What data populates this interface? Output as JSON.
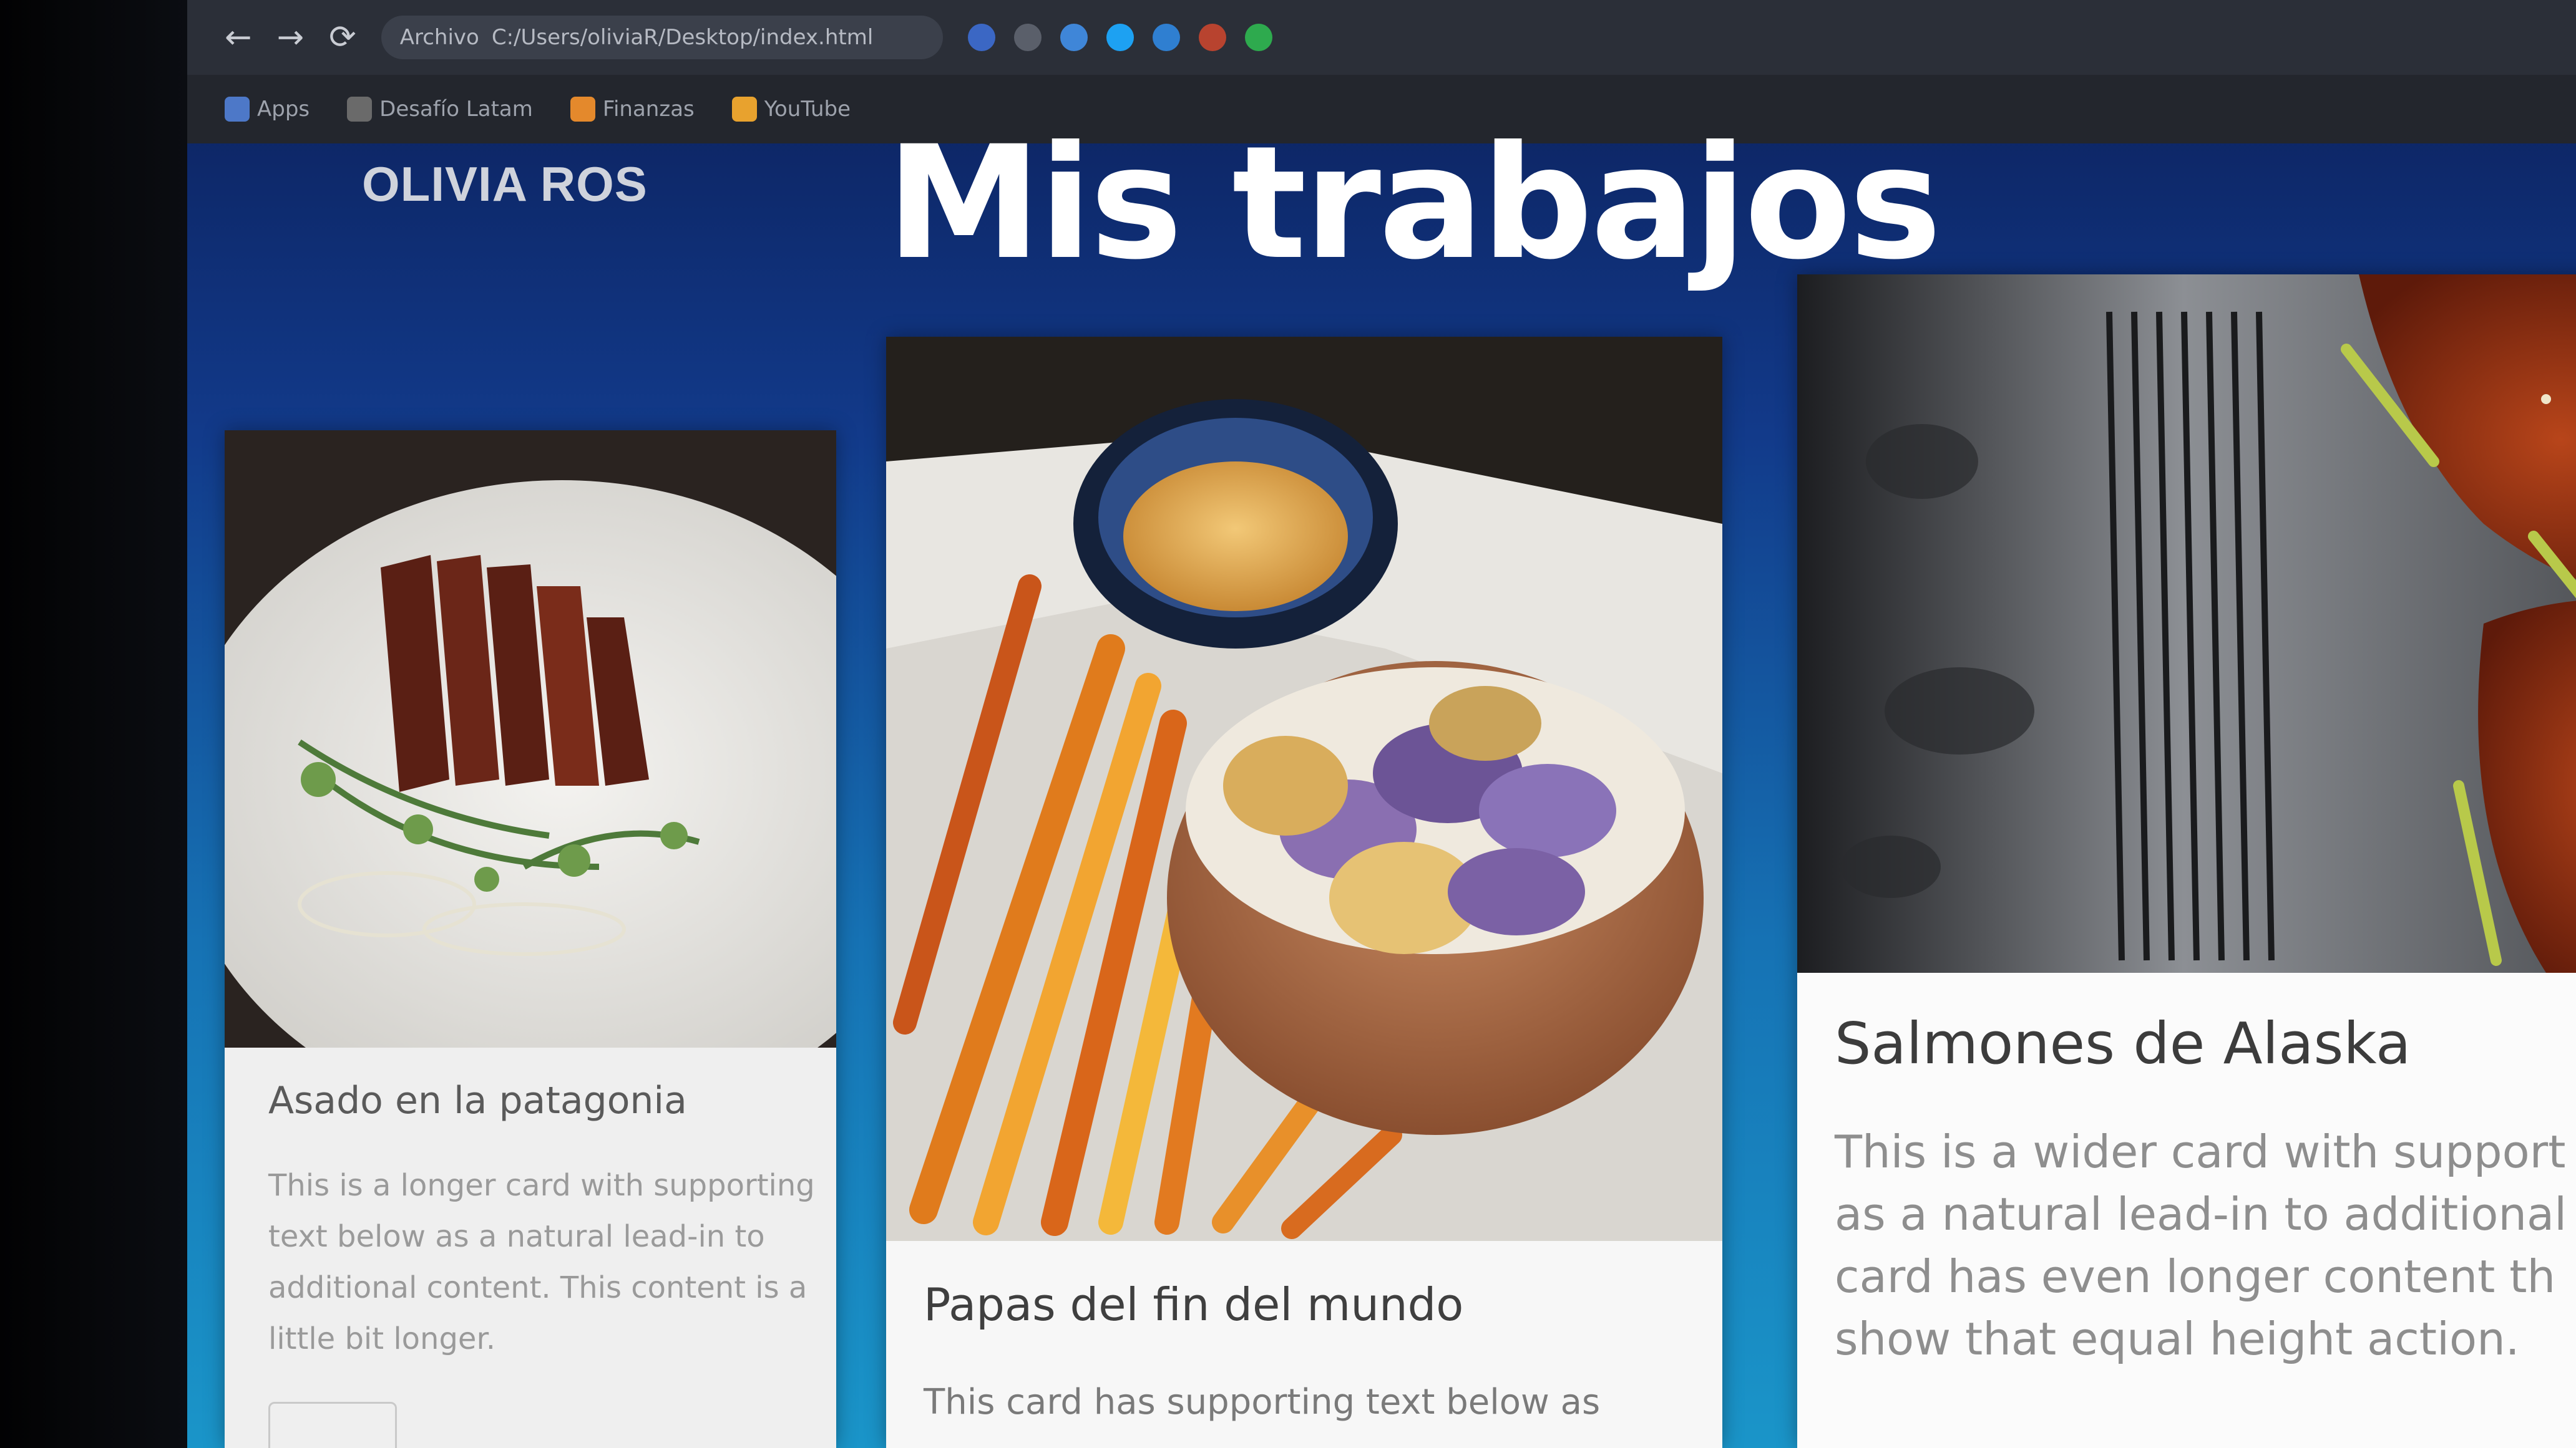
{
  "browser": {
    "back_icon": "←",
    "forward_icon": "→",
    "reload_icon": "⟳",
    "url_prefix": "Archivo",
    "url": "C:/Users/oliviaR/Desktop/index.html"
  },
  "bookmarks": [
    {
      "label": "Apps",
      "color": "#4d78c8"
    },
    {
      "label": "Desafío Latam",
      "color": "#6a6a6a"
    },
    {
      "label": "Finanzas",
      "color": "#e4892c"
    },
    {
      "label": "YouTube",
      "color": "#e8a22e"
    }
  ],
  "header": {
    "brand": "OLIVIA ROS",
    "title": "Mis trabajos"
  },
  "cards": [
    {
      "title": "Asado en la patagonia",
      "text": "This is a longer card with supporting text below as a natural lead-in to additional content. This content is a little bit longer.",
      "image": "grilled-meat-plate"
    },
    {
      "title": "Papas del fin del mundo",
      "text": "This card has supporting text below as",
      "image": "roasted-carrots-and-potato-chips"
    },
    {
      "title": "Salmones de Alaska",
      "text_lines": [
        "This is a wider card with support",
        "as a natural lead-in to additional",
        "card has even longer content th",
        "show that equal height action."
      ],
      "image": "glazed-salmon-on-slate"
    }
  ],
  "colors": {
    "background_top": "#0b1e57",
    "background_bottom": "#1a95c9",
    "title": "#ffffff",
    "brand": "#cfd3dc"
  }
}
